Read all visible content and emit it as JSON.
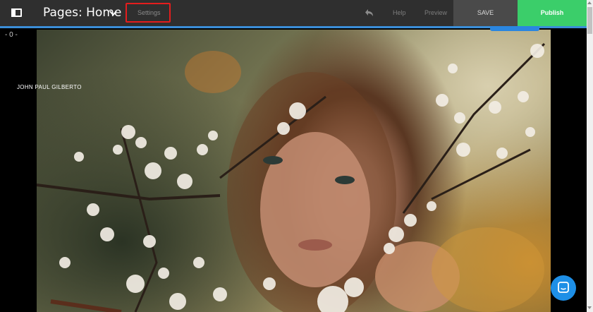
{
  "toolbar": {
    "pages_title": "Pages: Home",
    "settings_label": "Settings",
    "help_label": "Help",
    "preview_label": "Preview",
    "save_label": "SAVE",
    "publish_label": "Publish"
  },
  "canvas": {
    "zoom_indicator": "- 0 -",
    "brand_name": "JOHN PAUL GILBERTO"
  },
  "icons": {
    "panel_toggle": "panel-toggle-icon",
    "chevron": "chevron-down-icon",
    "undo": "undo-icon",
    "chat": "chat-bubble-icon"
  },
  "colors": {
    "toolbar_bg": "#2f2f2f",
    "save_bg": "#4a4a4a",
    "publish_bg": "#3bce6a",
    "accent_blue": "#3b8ed8",
    "highlight_red": "#e41d1d",
    "chat_blue": "#1e8fe6"
  }
}
